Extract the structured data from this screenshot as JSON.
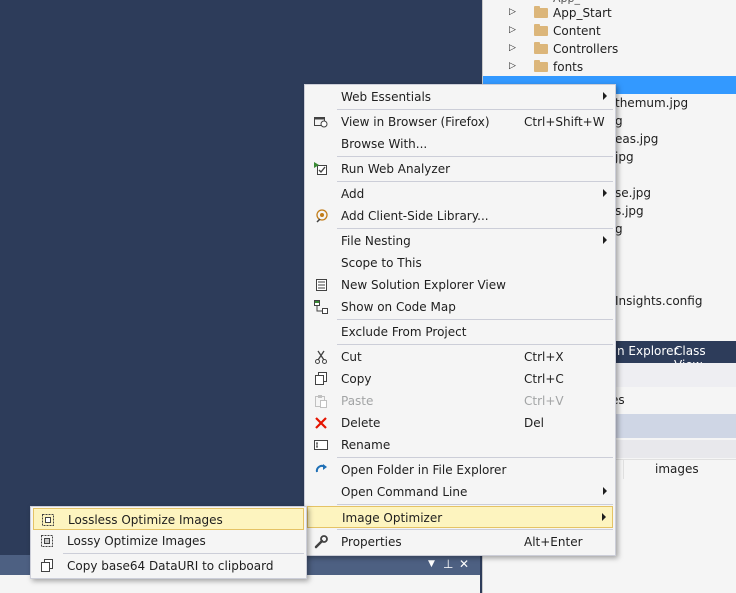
{
  "solution_explorer": {
    "tree": [
      {
        "label": "App_Start"
      },
      {
        "label": "Content"
      },
      {
        "label": "Controllers"
      },
      {
        "label": "fonts"
      }
    ],
    "files": [
      "themum.jpg",
      "g",
      "eas.jpg",
      "jpg",
      "se.jpg",
      "s.jpg",
      "g"
    ],
    "config_file": "Insights.config",
    "tabs": [
      "n Explorer",
      "Class View"
    ],
    "props": {
      "row1_value": "es",
      "row2_value": "images"
    }
  },
  "bottom_panel": {
    "controls": [
      "▼",
      "⊥",
      "✕"
    ]
  },
  "context_menu": {
    "items": [
      {
        "label": "Web Essentials",
        "submenu": true,
        "icon": "none"
      },
      {
        "label": "View in Browser (Firefox)",
        "shortcut": "Ctrl+Shift+W",
        "icon": "browser-icon"
      },
      {
        "label": "Browse With...",
        "icon": "none"
      },
      {
        "label": "Run Web Analyzer",
        "icon": "analyzer-icon"
      },
      {
        "label": "Add",
        "submenu": true,
        "icon": "none"
      },
      {
        "label": "Add Client-Side Library...",
        "icon": "library-icon"
      },
      {
        "label": "File Nesting",
        "submenu": true,
        "icon": "none"
      },
      {
        "label": "Scope to This",
        "icon": "none"
      },
      {
        "label": "New Solution Explorer View",
        "icon": "new-view-icon"
      },
      {
        "label": "Show on Code Map",
        "icon": "code-map-icon"
      },
      {
        "label": "Exclude From Project",
        "icon": "none"
      },
      {
        "label": "Cut",
        "shortcut": "Ctrl+X",
        "icon": "scissors-icon"
      },
      {
        "label": "Copy",
        "shortcut": "Ctrl+C",
        "icon": "copy-icon"
      },
      {
        "label": "Paste",
        "shortcut": "Ctrl+V",
        "icon": "paste-icon",
        "disabled": true
      },
      {
        "label": "Delete",
        "shortcut": "Del",
        "icon": "delete-icon"
      },
      {
        "label": "Rename",
        "icon": "rename-icon"
      },
      {
        "label": "Open Folder in File Explorer",
        "icon": "refresh-arrow-icon"
      },
      {
        "label": "Open Command Line",
        "submenu": true,
        "icon": "none"
      },
      {
        "label": "Image Optimizer",
        "submenu": true,
        "icon": "none",
        "highlighted": true
      },
      {
        "label": "Properties",
        "shortcut": "Alt+Enter",
        "icon": "wrench-icon"
      }
    ]
  },
  "image_optimizer_submenu": {
    "items": [
      {
        "label": "Lossless Optimize Images",
        "icon": "lossless-icon",
        "highlighted": true
      },
      {
        "label": "Lossy Optimize Images",
        "icon": "lossy-icon"
      },
      {
        "label": "Copy base64 DataURI to clipboard",
        "icon": "copy-icon"
      }
    ]
  },
  "colors": {
    "background": "#2d3c5a",
    "highlight": "#fdf4bf",
    "selection": "#3399ff",
    "delete_red": "#e51400"
  }
}
